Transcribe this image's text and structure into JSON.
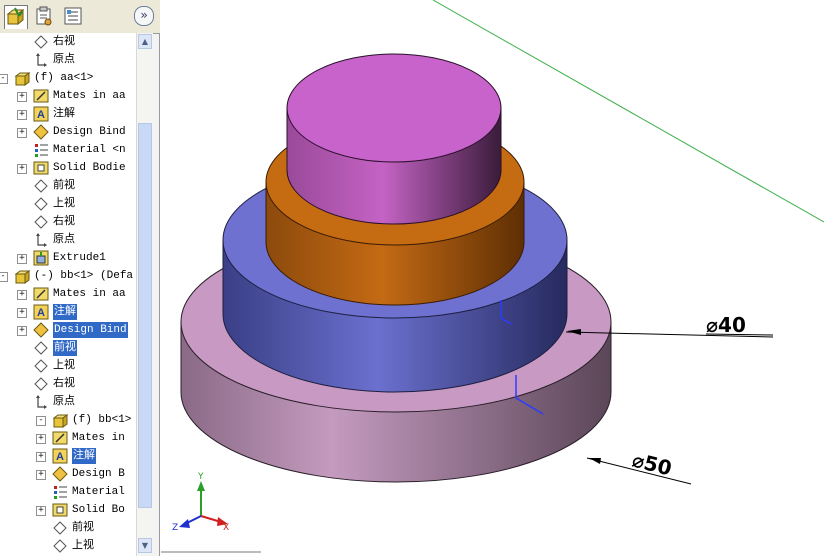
{
  "toolbar": {
    "collapse_label": "»"
  },
  "tabs": [
    {
      "name": "feature-manager",
      "icon": "feature-tree-icon",
      "active": true
    },
    {
      "name": "property-manager",
      "icon": "property-icon",
      "active": false
    },
    {
      "name": "configuration-manager",
      "icon": "configuration-icon",
      "active": false
    }
  ],
  "tree": {
    "items": [
      {
        "label": "右视",
        "icon": "plane-icon"
      },
      {
        "label": "原点",
        "icon": "origin-icon"
      },
      {
        "label": "(f) aa<1>",
        "icon": "part-icon",
        "expander": "-"
      },
      {
        "label": "Mates in aa",
        "icon": "mates-icon",
        "expander": "+"
      },
      {
        "label": "注解",
        "icon": "annotation-icon",
        "expander": "+"
      },
      {
        "label": "Design Bind",
        "icon": "design-binder-icon",
        "expander": "+"
      },
      {
        "label": "Material <n",
        "icon": "material-icon"
      },
      {
        "label": "Solid Bodie",
        "icon": "solid-bodies-icon",
        "expander": "+"
      },
      {
        "label": "前视",
        "icon": "plane-icon"
      },
      {
        "label": "上视",
        "icon": "plane-icon"
      },
      {
        "label": "右视",
        "icon": "plane-icon"
      },
      {
        "label": "原点",
        "icon": "origin-icon"
      },
      {
        "label": "Extrude1",
        "icon": "extrude-icon",
        "expander": "+"
      },
      {
        "label": "(-) bb<1> (Defa",
        "icon": "part-icon",
        "expander": "-"
      },
      {
        "label": "Mates in aa",
        "icon": "mates-icon",
        "expander": "+"
      },
      {
        "label": "注解",
        "icon": "annotation-icon",
        "expander": "+",
        "selected": true
      },
      {
        "label": "Design Bind",
        "icon": "design-binder-icon",
        "expander": "+",
        "selected": true
      },
      {
        "label": "前视",
        "icon": "plane-icon",
        "selected": true
      },
      {
        "label": "上视",
        "icon": "plane-icon"
      },
      {
        "label": "右视",
        "icon": "plane-icon"
      },
      {
        "label": "原点",
        "icon": "origin-icon"
      },
      {
        "label": "(f) bb<1>",
        "icon": "part-icon",
        "expander": "-"
      },
      {
        "label": "Mates in",
        "icon": "mates-icon",
        "expander": "+"
      },
      {
        "label": "注解",
        "icon": "annotation-icon",
        "expander": "+",
        "selected": true
      },
      {
        "label": "Design B",
        "icon": "design-binder-icon",
        "expander": "+"
      },
      {
        "label": "Material",
        "icon": "material-icon"
      },
      {
        "label": "Solid Bo",
        "icon": "solid-bodies-icon",
        "expander": "+"
      },
      {
        "label": "前视",
        "icon": "plane-icon"
      },
      {
        "label": "上视",
        "icon": "plane-icon"
      }
    ]
  },
  "viewport": {
    "dimensions": [
      "⌀40",
      "⌀50"
    ],
    "axes": [
      "Y",
      "Z",
      "X"
    ]
  }
}
